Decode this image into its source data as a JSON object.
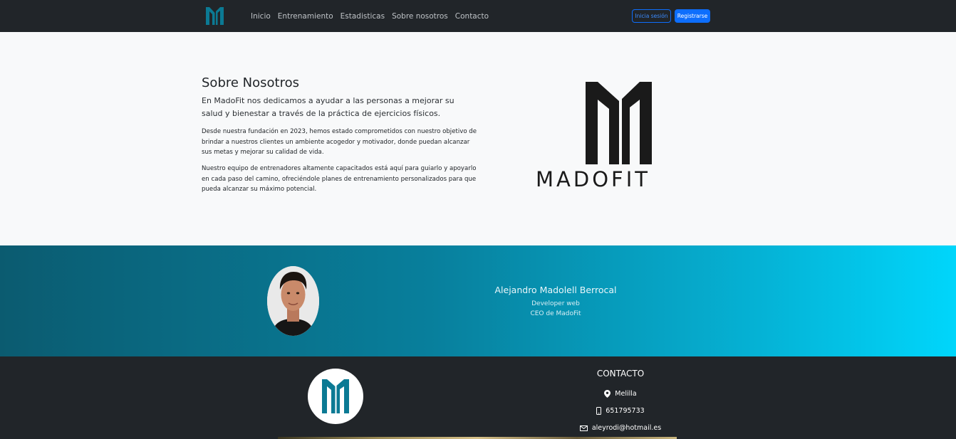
{
  "navbar": {
    "links": [
      "Inicio",
      "Entrenamiento",
      "Estadisticas",
      "Sobre nosotros",
      "Contacto"
    ],
    "login_label": "Inicia sesión",
    "register_label": "Registrarse"
  },
  "about": {
    "title": "Sobre Nosotros",
    "lead": "En MadoFit nos dedicamos a ayudar a las personas a mejorar su salud y bienestar a través de la práctica de ejercicios físicos.",
    "paragraph_1": "Desde nuestra fundación en 2023, hemos estado comprometidos con nuestro objetivo de brindar a nuestros clientes un ambiente acogedor y motivador, donde puedan alcanzar sus metas y mejorar su calidad de vida.",
    "paragraph_2": "Nuestro equipo de entrenadores altamente capacitados está aquí para guiarlo y apoyarlo en cada paso del camino, ofreciéndole planes de entrenamiento personalizados para que pueda alcanzar su máximo potencial.",
    "brand_word": "MADOFIT"
  },
  "team": {
    "name": "Alejandro Madolell Berrocal",
    "role": "Developer web",
    "title": "CEO de MadoFit"
  },
  "footer": {
    "contact_title": "CONTACTO",
    "location": "Melilla",
    "phone": "651795733",
    "email": "aleyrodi@hotmail.es"
  },
  "colors": {
    "navbar_bg": "#212529",
    "brand_teal": "#0b7a94",
    "primary_blue": "#0d6efd",
    "gradient_start": "#0b5b70",
    "gradient_end": "#00d6fb"
  }
}
